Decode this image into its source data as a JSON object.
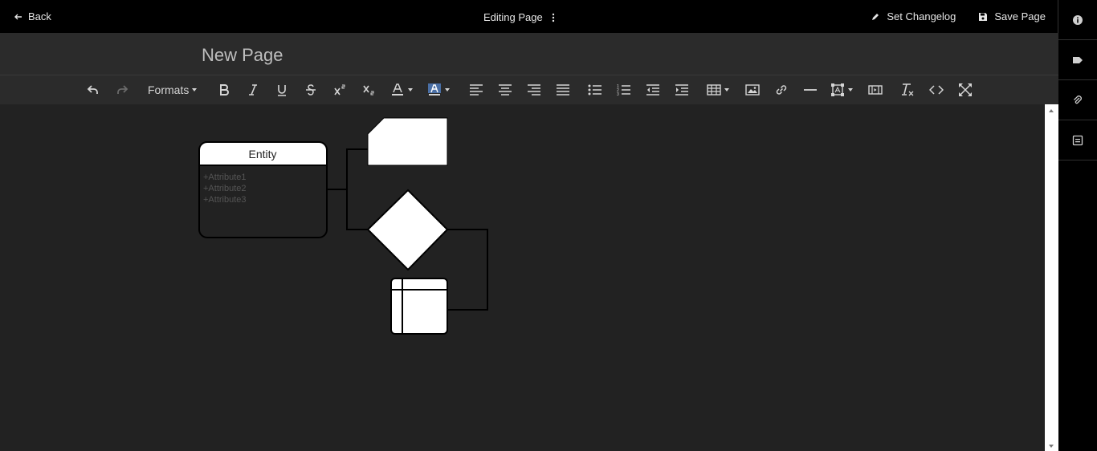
{
  "header": {
    "back_label": "Back",
    "center_title": "Editing Page",
    "set_changelog_label": "Set Changelog",
    "save_page_label": "Save Page"
  },
  "page": {
    "title": "New Page"
  },
  "toolbar": {
    "formats_label": "Formats",
    "buttons": [
      "undo",
      "redo",
      "formats",
      "bold",
      "italic",
      "underline",
      "strikethrough",
      "superscript",
      "subscript",
      "text-color",
      "background-color",
      "align-left",
      "align-center",
      "align-right",
      "justify",
      "bullet-list",
      "numbered-list",
      "outdent",
      "indent",
      "table",
      "image",
      "link",
      "horizontal-line",
      "insert-box",
      "media",
      "clear-formatting",
      "source-code",
      "fullscreen"
    ]
  },
  "sidebar": {
    "items": [
      "info-icon",
      "tag-icon",
      "attachment-icon",
      "template-icon"
    ]
  },
  "diagram": {
    "entity": {
      "title": "Entity",
      "attributes": [
        "+Attribute1",
        "+Attribute2",
        "+Attribute3"
      ]
    }
  },
  "colors": {
    "background": "#222222",
    "header": "#000000",
    "toolbar": "#2b2b2b",
    "shape_fill": "#ffffff"
  }
}
